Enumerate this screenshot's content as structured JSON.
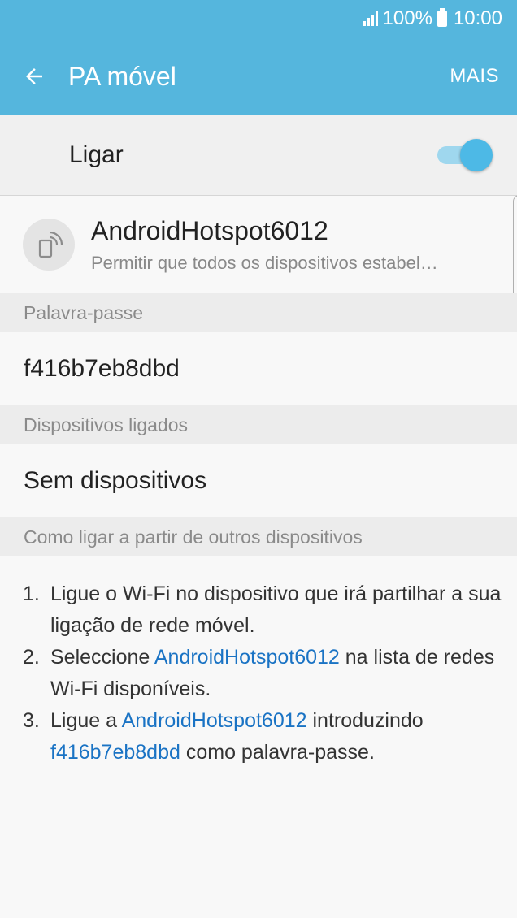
{
  "status_bar": {
    "battery": "100%",
    "time": "10:00",
    "icons": [
      "signal-icon",
      "battery-icon"
    ]
  },
  "app_bar": {
    "title": "PA móvel",
    "back_icon": "arrow-left-icon",
    "more_label": "MAIS"
  },
  "master_switch": {
    "label": "Ligar",
    "checked": true
  },
  "network": {
    "icon": "hotspot-icon",
    "name": "AndroidHotspot6012",
    "summary": "Permitir que todos os dispositivos estabel…"
  },
  "password_section": {
    "header": "Palavra-passe",
    "value": "f416b7eb8dbd"
  },
  "devices_section": {
    "header": "Dispositivos ligados",
    "value": "Sem dispositivos"
  },
  "howto_section": {
    "header": "Como ligar a partir de outros dispositivos",
    "steps": [
      {
        "num": "1.",
        "parts": [
          "Ligue o Wi-Fi no dispositivo que irá partilhar a sua ligação de rede móvel."
        ]
      },
      {
        "num": "2.",
        "parts": [
          "Seleccione ",
          "AndroidHotspot6012",
          " na lista de redes Wi-Fi disponíveis."
        ]
      },
      {
        "num": "3.",
        "parts": [
          "Ligue a ",
          "AndroidHotspot6012",
          " introduzindo ",
          "f416b7eb8dbd",
          " como palavra-passe."
        ]
      }
    ]
  },
  "colors": {
    "accent": "#55b6dd",
    "link": "#1a73c4",
    "toggle_on": "#4db9e6"
  }
}
